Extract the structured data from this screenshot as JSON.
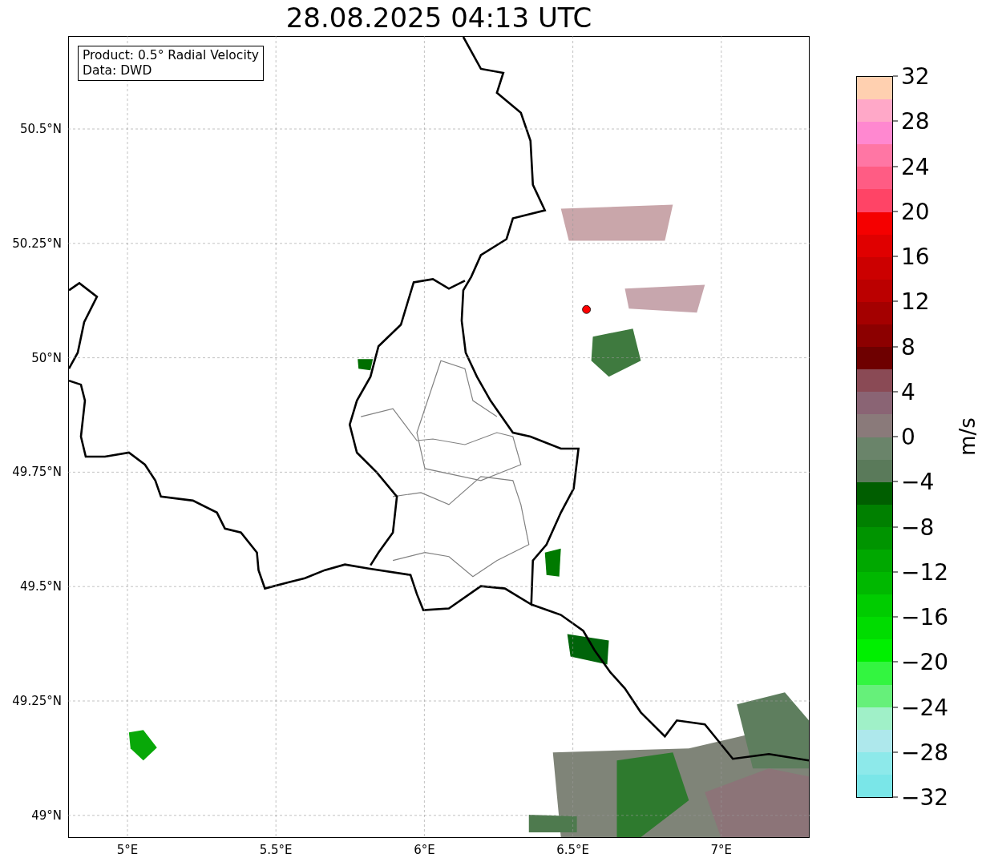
{
  "title": "28.08.2025 04:13 UTC",
  "info_box": {
    "lines": [
      "Product: 0.5° Radial Velocity",
      "Data: DWD"
    ]
  },
  "map": {
    "lat_labels": [
      "50.5°N",
      "50.25°N",
      "50°N",
      "49.75°N",
      "49.5°N",
      "49.25°N",
      "49°N"
    ],
    "lon_labels": [
      "5°E",
      "5.5°E",
      "6°E",
      "6.5°E",
      "7°E"
    ]
  },
  "colorbar": {
    "label": "m/s",
    "ticks": [
      "32",
      "28",
      "24",
      "20",
      "16",
      "12",
      "8",
      "4",
      "0",
      "−4",
      "−8",
      "−12",
      "−16",
      "−20",
      "−24",
      "−28",
      "−32"
    ],
    "bands": [
      {
        "color": "#ffd0b0"
      },
      {
        "color": "#ffa8c8"
      },
      {
        "color": "#ff88d0"
      },
      {
        "color": "#ff76a4"
      },
      {
        "color": "#ff5c84"
      },
      {
        "color": "#ff4466"
      },
      {
        "color": "#f50000"
      },
      {
        "color": "#e00000"
      },
      {
        "color": "#cc0000"
      },
      {
        "color": "#bb0000"
      },
      {
        "color": "#a40000"
      },
      {
        "color": "#8c0000"
      },
      {
        "color": "#6e0000"
      },
      {
        "color": "#8a4a55"
      },
      {
        "color": "#8a6474"
      },
      {
        "color": "#8a7a7a"
      },
      {
        "color": "#6a846a"
      },
      {
        "color": "#5a7a5a"
      },
      {
        "color": "#005e00"
      },
      {
        "color": "#008000"
      },
      {
        "color": "#009400"
      },
      {
        "color": "#00a800"
      },
      {
        "color": "#00b800"
      },
      {
        "color": "#00cc00"
      },
      {
        "color": "#00dc00"
      },
      {
        "color": "#00f000"
      },
      {
        "color": "#33f540"
      },
      {
        "color": "#66f07a"
      },
      {
        "color": "#a0f0c8"
      },
      {
        "color": "#aee8ec"
      },
      {
        "color": "#8de9ea"
      },
      {
        "color": "#7ae6e8"
      }
    ]
  }
}
